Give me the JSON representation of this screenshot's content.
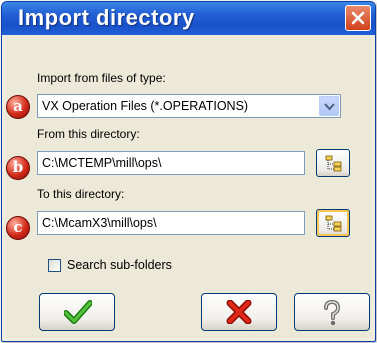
{
  "window": {
    "title": "Import directory"
  },
  "labels": {
    "file_type": "Import from files of type:",
    "from_dir": "From this directory:",
    "to_dir": "To this directory:",
    "search_subfolders": "Search sub-folders"
  },
  "fields": {
    "file_type_value": "VX Operation Files (*.OPERATIONS)",
    "from_dir_value": "C:\\MCTEMP\\mill\\ops\\",
    "to_dir_value": "C:\\McamX3\\mill\\ops\\"
  },
  "markers": [
    "a",
    "b",
    "c"
  ],
  "checkbox": {
    "search_subfolders_checked": false
  },
  "icons": {
    "close": "close-icon",
    "dropdown": "chevron-down-icon",
    "browse": "folder-tree-icon",
    "ok": "checkmark-icon",
    "cancel": "x-icon",
    "help": "question-mark-icon"
  },
  "colors": {
    "title_bar": "#2461d6",
    "dialog_bg": "#ece9d8",
    "ok_green": "#2f9e1e",
    "cancel_red": "#d51d0e",
    "marker_red": "#d32a1a"
  }
}
